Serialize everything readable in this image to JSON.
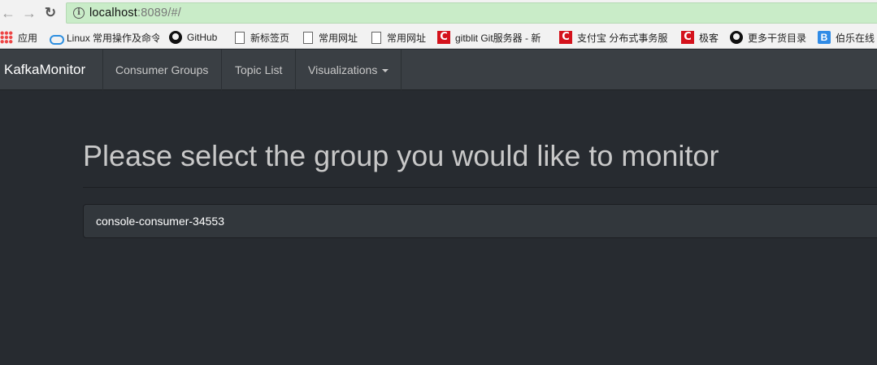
{
  "browser": {
    "url_host": "localhost",
    "url_rest": ":8089/#/"
  },
  "bookmarks": [
    {
      "label": "应用",
      "icon": "apps-grid-icon"
    },
    {
      "label": "Linux 常用操作及命令",
      "icon": "cloud-icon"
    },
    {
      "label": "GitHub",
      "icon": "github-icon"
    },
    {
      "label": "新标签页",
      "icon": "page-icon"
    },
    {
      "label": "常用网址",
      "icon": "page-icon"
    },
    {
      "label": "常用网址",
      "icon": "page-icon"
    },
    {
      "label": "gitblit Git服务器 - 新",
      "icon": "csdn-icon"
    },
    {
      "label": "支付宝 分布式事务服",
      "icon": "csdn-icon"
    },
    {
      "label": "极客",
      "icon": "csdn-icon"
    },
    {
      "label": "更多干货目录",
      "icon": "github-icon"
    },
    {
      "label": "伯乐在线",
      "icon": "bole-icon"
    }
  ],
  "navbar": {
    "brand": "KafkaMonitor",
    "items": [
      {
        "label": "Consumer Groups"
      },
      {
        "label": "Topic List"
      },
      {
        "label": "Visualizations"
      }
    ]
  },
  "main": {
    "heading": "Please select the group you would like to monitor",
    "groups": [
      {
        "name": "console-consumer-34553"
      }
    ]
  }
}
